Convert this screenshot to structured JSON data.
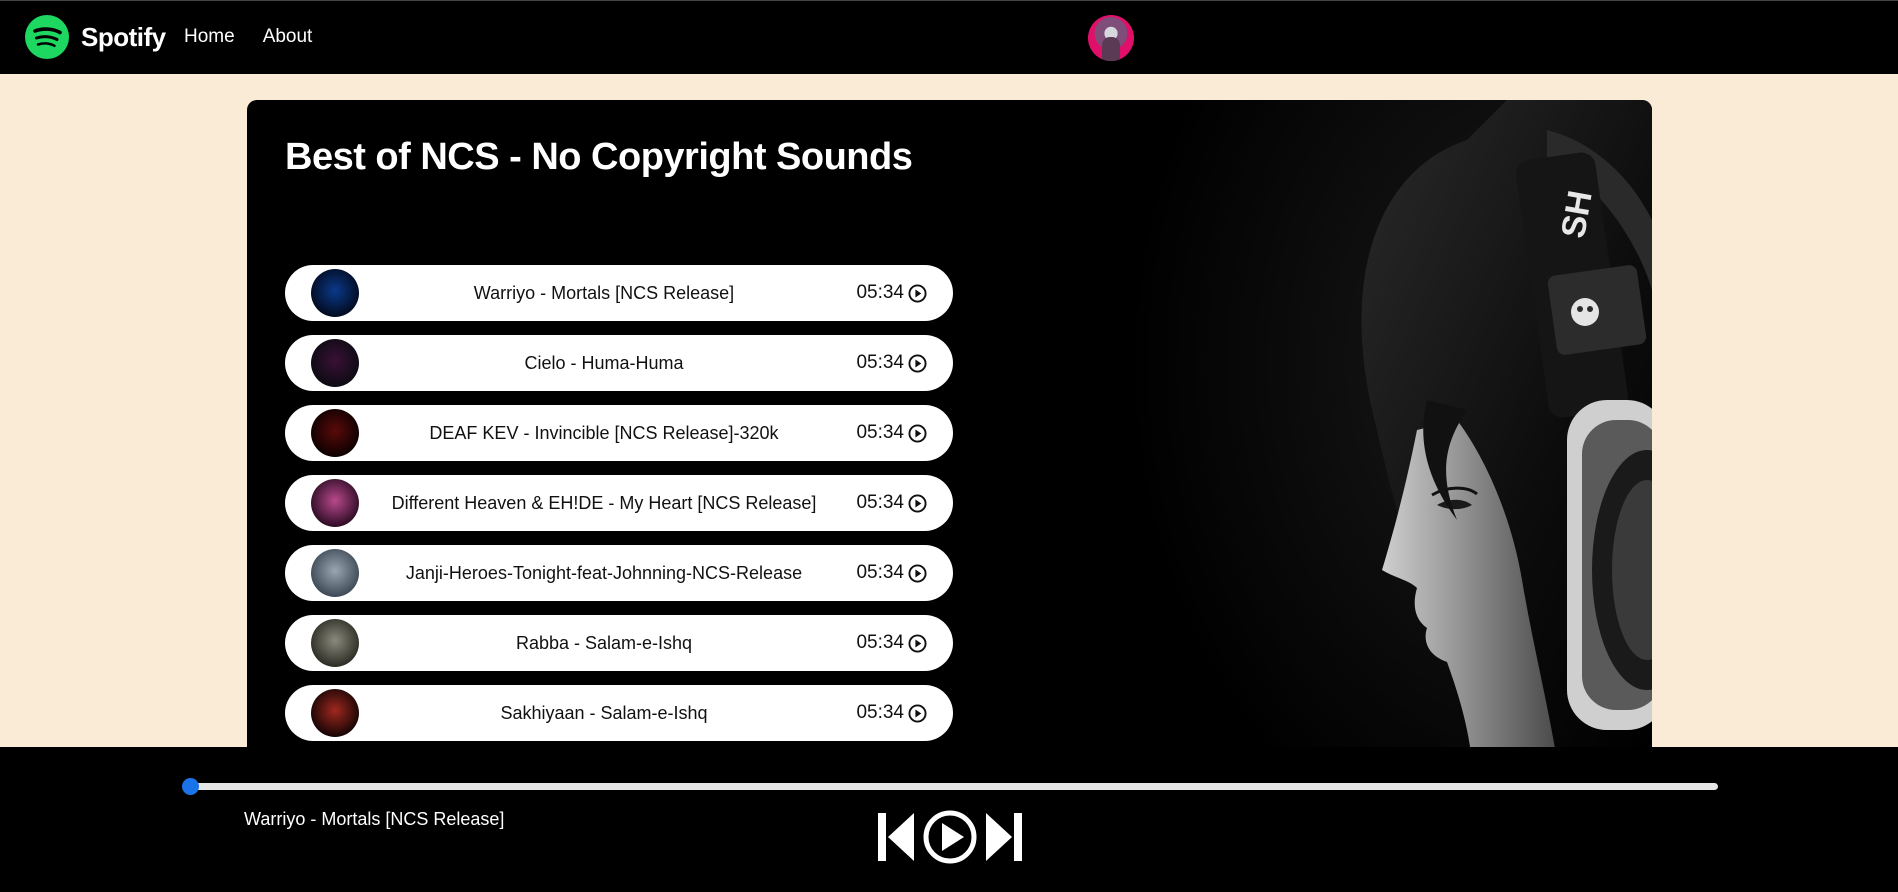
{
  "navbar": {
    "brand": "Spotify",
    "links": [
      "Home",
      "About"
    ]
  },
  "playlist": {
    "title": "Best of NCS - No Copyright Sounds",
    "songs": [
      {
        "name": "Warriyo - Mortals [NCS Release]",
        "time": "05:34",
        "cover_colors": [
          "#0a3a8a",
          "#02091c"
        ]
      },
      {
        "name": "Cielo - Huma-Huma",
        "time": "05:34",
        "cover_colors": [
          "#3a1036",
          "#0b0b12"
        ]
      },
      {
        "name": "DEAF KEV - Invincible [NCS Release]-320k",
        "time": "05:34",
        "cover_colors": [
          "#5a0a0a",
          "#0b0000"
        ]
      },
      {
        "name": "Different Heaven & EH!DE - My Heart [NCS Release]",
        "time": "05:34",
        "cover_colors": [
          "#b84a8c",
          "#2a0a22"
        ]
      },
      {
        "name": "Janji-Heroes-Tonight-feat-Johnning-NCS-Release",
        "time": "05:34",
        "cover_colors": [
          "#9aa7b3",
          "#3b4752"
        ]
      },
      {
        "name": "Rabba - Salam-e-Ishq",
        "time": "05:34",
        "cover_colors": [
          "#8a8a7c",
          "#2a2a22"
        ]
      },
      {
        "name": "Sakhiyaan - Salam-e-Ishq",
        "time": "05:34",
        "cover_colors": [
          "#a0281e",
          "#120404"
        ]
      }
    ]
  },
  "player": {
    "now_playing": "Warriyo - Mortals [NCS Release]",
    "progress": 0,
    "accent_color": "#1a73e8"
  },
  "icons": {
    "logo": "spotify-logo-icon",
    "play": "play-circle-icon",
    "previous": "skip-previous-icon",
    "next": "skip-next-icon"
  },
  "colors": {
    "background": "#faebd7",
    "brand_green": "#1ed760"
  }
}
